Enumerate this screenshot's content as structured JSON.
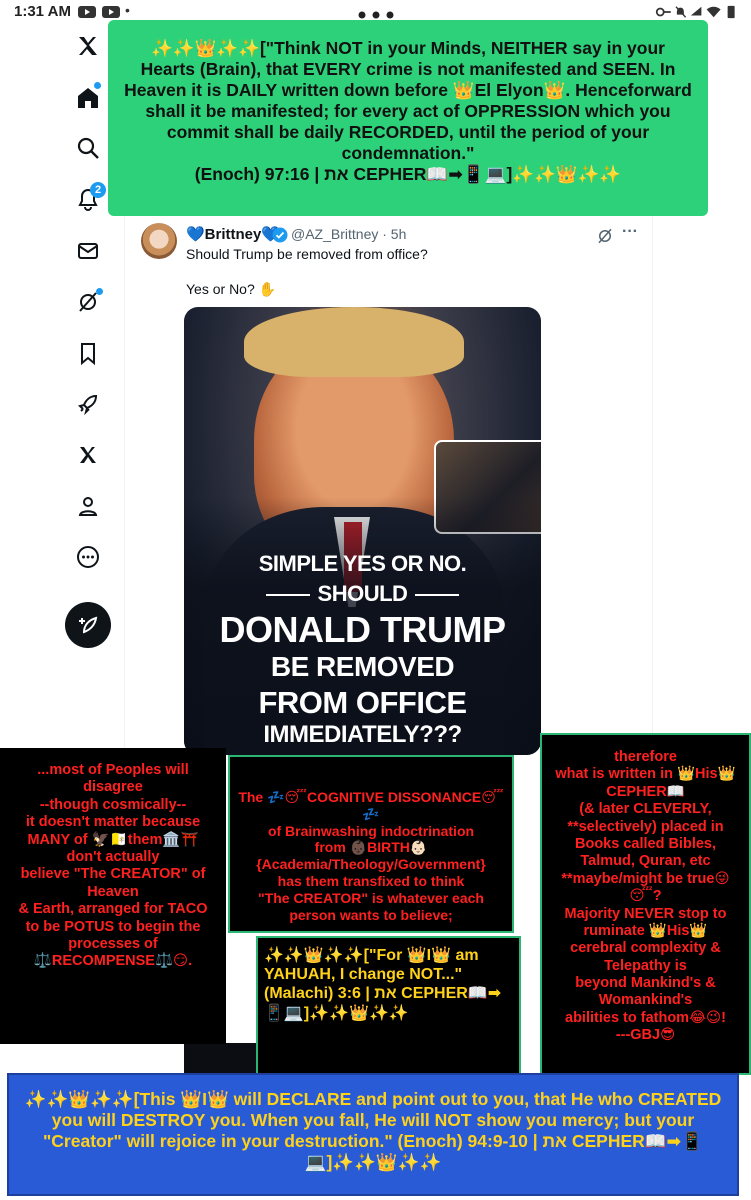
{
  "status_bar": {
    "time": "1:31 AM"
  },
  "sidebar": {
    "items": [
      {
        "icon": "x-logo-icon"
      },
      {
        "icon": "home-icon"
      },
      {
        "icon": "search-icon"
      },
      {
        "icon": "notifications-icon",
        "badge": "2"
      },
      {
        "icon": "messages-icon"
      },
      {
        "icon": "grok-icon"
      },
      {
        "icon": "bookmarks-icon"
      },
      {
        "icon": "rocket-icon"
      },
      {
        "icon": "x-premium-icon"
      },
      {
        "icon": "profile-icon"
      },
      {
        "icon": "more-icon"
      }
    ],
    "compose_icon": "compose-post-icon"
  },
  "tweet": {
    "display_name": "💙Brittney💙",
    "handle_time": "@AZ_Brittney · 5h",
    "text_line1": "Should Trump be removed from office?",
    "text_line2": "Yes or No? ✋",
    "image": {
      "line1": "SIMPLE YES OR NO.",
      "line2": "SHOULD",
      "line3": "DONALD TRUMP",
      "line4": "BE REMOVED",
      "line5": "FROM OFFICE",
      "line6": "IMMEDIATELY???"
    }
  },
  "overlays": {
    "top": "✨✨👑✨✨[\"Think NOT in your Minds, NEITHER say in your Hearts (Brain), that EVERY crime is not manifested and SEEN. In Heaven it is DAILY written down before 👑El Elyon👑. Henceforward shall it be manifested; for every act of OPPRESSION which you commit shall be daily RECORDED, until the period of your condemnation.\"\n(Enoch) 97:16 | את CEPHER📖➡📱💻]✨✨👑✨✨",
    "left": "...most of Peoples will disagree\n--though cosmically--\nit doesn't matter because MANY of 🦅🇻🇦them🏛️⛩️ don't actually\nbelieve \"The CREATOR\" of Heaven\n& Earth, arranged for TACO to be POTUS to begin the\nprocesses of\n⚖️RECOMPENSE⚖️😏.",
    "middle": "The 💤😴COGNITIVE DISSONANCE😴💤\nof Brainwashing indoctrination\nfrom 👶🏿BIRTH👶🏻\n{Academia/Theology/Government}\nhas them transfixed to think\n\"The CREATOR\" is whatever each\nperson wants to believe;",
    "small": "✨✨👑✨✨[\"For 👑I👑 am YAHUAH, I change NOT...\"\n(Malachi) 3:6 | את CEPHER📖➡📱💻]✨✨👑✨✨",
    "right": "therefore\nwhat is written in 👑His👑\nCEPHER📖\n(& later CLEVERLY,\n**selectively) placed in\nBooks called Bibles,\nTalmud, Quran, etc\n**maybe/might be true😜😴?\nMajority NEVER stop to\nruminate 👑His👑\ncerebral complexity &\nTelepathy is\nbeyond Mankind's &\nWomankind's\nabilities to fathom😂😉!\n---GBJ😎",
    "bottom": "✨✨👑✨✨[This 👑I👑 will DECLARE and point out to you, that He who CREATED you will DESTROY you. When you fall, He will NOT show you mercy; but your \"Creator\" will rejoice in your destruction.\" (Enoch) 94:9-10 | את CEPHER📖➡📱💻]✨✨👑✨✨"
  },
  "colors": {
    "green_box": "#2dd179",
    "blue_box": "#2a5bd7",
    "red_text": "#ff2020",
    "yellow_text": "#ffd21a",
    "x_blue": "#1d9bf0"
  }
}
